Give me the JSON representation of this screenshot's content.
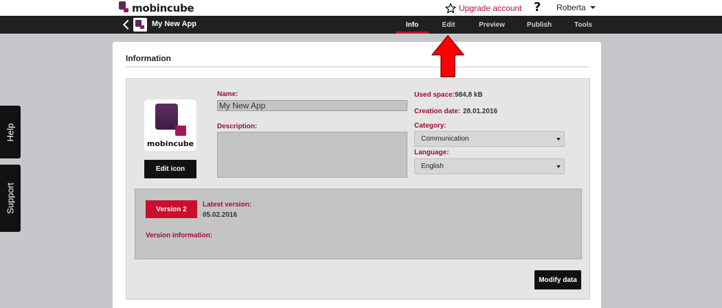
{
  "brand": {
    "name": "mobincube",
    "mark_colors": [
      "#5a2a5e",
      "#a0195a"
    ]
  },
  "header": {
    "upgrade_label": "Upgrade account",
    "help_label": "?",
    "user_name": "Roberta"
  },
  "nav": {
    "app_name": "My New App",
    "tabs": [
      {
        "label": "Info",
        "active": true
      },
      {
        "label": "Edit",
        "active": false
      },
      {
        "label": "Preview",
        "active": false
      },
      {
        "label": "Publish",
        "active": false
      },
      {
        "label": "Tools",
        "active": false
      }
    ]
  },
  "side": {
    "help_label": "Help",
    "support_label": "Support"
  },
  "info": {
    "section_title": "Information",
    "icon_wordmark": "mobincube",
    "edit_icon_label": "Edit icon",
    "name_label": "Name:",
    "name_value": "My New App",
    "description_label": "Description:",
    "description_value": "",
    "used_space_label": "Used space:",
    "used_space_value": "984,8 kB",
    "creation_date_label": "Creation date:",
    "creation_date_value": "28.01.2016",
    "category_label": "Category:",
    "category_value": "Communication",
    "language_label": "Language:",
    "language_value": "English",
    "version": {
      "badge": "Version 2",
      "latest_label": "Latest version:",
      "latest_date": "05.02.2016",
      "info_label": "Version information:"
    },
    "modify_label": "Modify data"
  },
  "colors": {
    "accent": "#c8102e",
    "label_red": "#9b1030",
    "nav_bg": "#202020",
    "page_bg": "#c6c7cb"
  }
}
